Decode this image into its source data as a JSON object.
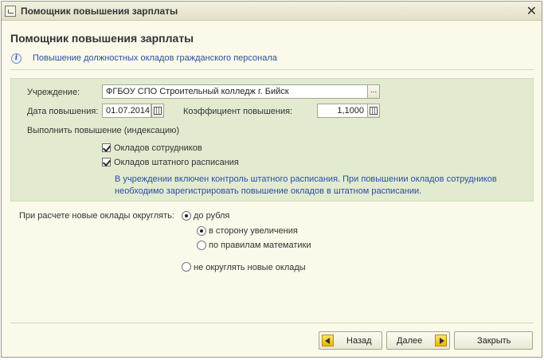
{
  "window": {
    "title": "Помощник повышения зарплаты"
  },
  "header": {
    "title": "Помощник повышения зарплаты",
    "info": "Повышение должностных окладов гражданского персонала"
  },
  "form": {
    "institution_label": "Учреждение:",
    "institution_value": "ФГБОУ СПО Строительный колледж г. Бийск",
    "select_button": "...",
    "date_label": "Дата повышения:",
    "date_value": "01.07.2014",
    "coef_label": "Коэффициент повышения:",
    "coef_value": "1,1000",
    "indexing_label": "Выполнить повышение (индексацию)",
    "chk_employees_label": "Окладов сотрудников",
    "chk_employees_checked": true,
    "chk_staff_label": "Окладов штатного расписания",
    "chk_staff_checked": true,
    "note": "В учреждении включен контроль штатного расписания. При повышении окладов сотрудников необходимо зарегистрировать повышение окладов в штатном расписании."
  },
  "rounding": {
    "label": "При расчете новые оклады округлять:",
    "to_ruble": "до рубля",
    "up": "в сторону увеличения",
    "math": "по правилам математики",
    "none": "не округлять новые оклады",
    "selected": "to_ruble",
    "sub_selected": "up"
  },
  "footer": {
    "back": "Назад",
    "next": "Далее",
    "close": "Закрыть"
  }
}
